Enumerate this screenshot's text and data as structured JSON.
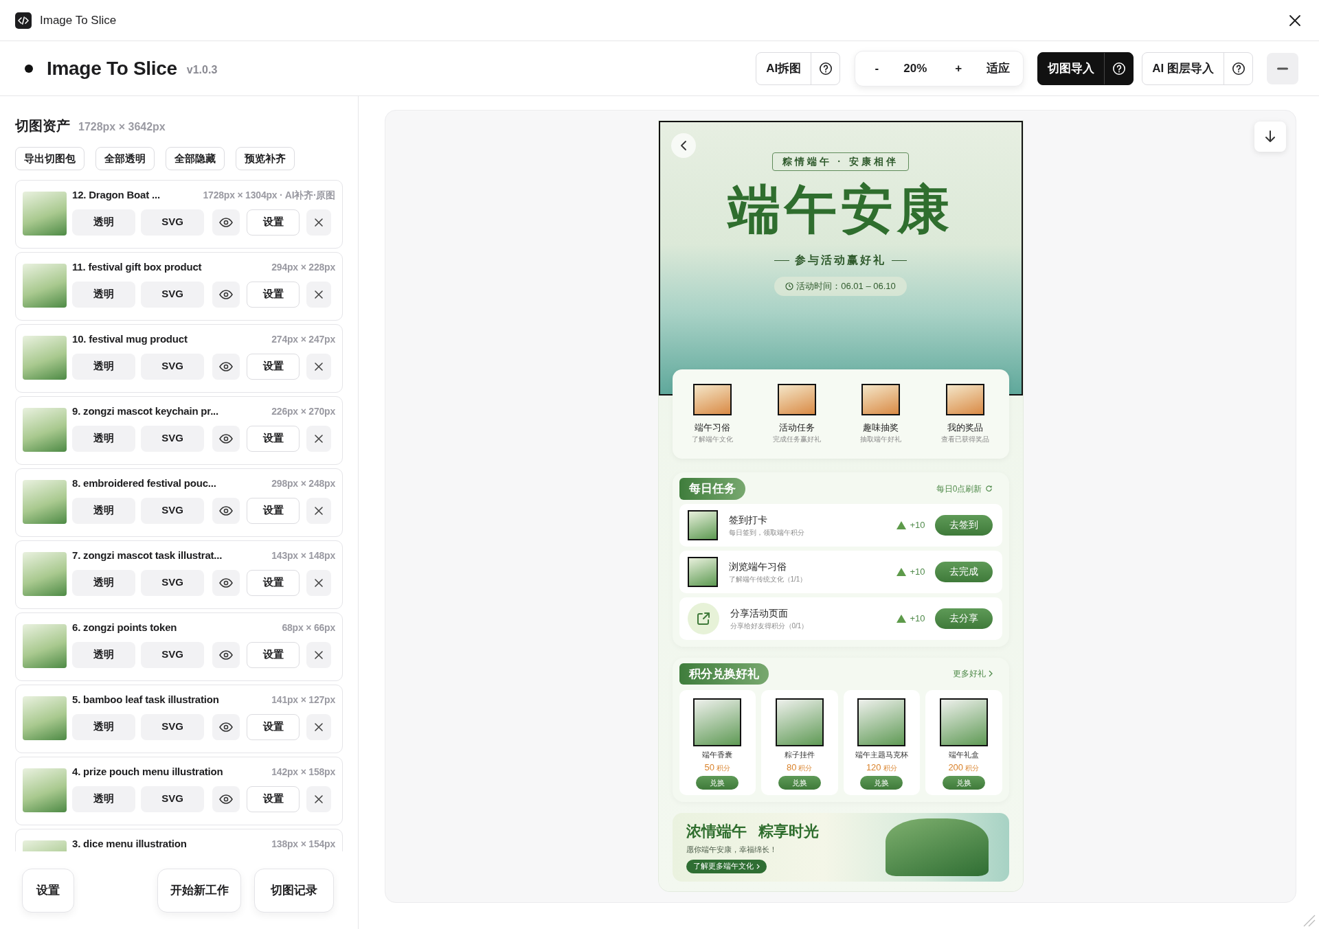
{
  "window": {
    "title": "Image To Slice"
  },
  "header": {
    "title": "Image To Slice",
    "version": "v1.0.3",
    "ai_split": {
      "label": "AI拆图"
    },
    "zoom": {
      "minus": "-",
      "value": "20%",
      "plus": "+",
      "fit": "适应"
    },
    "slice_import": {
      "label": "切图导入"
    },
    "ai_layer_import": {
      "label": "AI 图层导入"
    }
  },
  "assets": {
    "title": "切图资产",
    "size": "1728px × 3642px",
    "actions": [
      "导出切图包",
      "全部透明",
      "全部隐藏",
      "预览补齐"
    ],
    "items": [
      {
        "name": "12. Dragon Boat ...",
        "size": "1728px × 1304px · AI补齐·原图",
        "transparent": "透明",
        "svg": "SVG",
        "settings": "设置"
      },
      {
        "name": "11. festival gift box product",
        "size": "294px × 228px",
        "transparent": "透明",
        "svg": "SVG",
        "settings": "设置"
      },
      {
        "name": "10. festival mug product",
        "size": "274px × 247px",
        "transparent": "透明",
        "svg": "SVG",
        "settings": "设置"
      },
      {
        "name": "9. zongzi mascot keychain pr...",
        "size": "226px × 270px",
        "transparent": "透明",
        "svg": "SVG",
        "settings": "设置"
      },
      {
        "name": "8. embroidered festival pouc...",
        "size": "298px × 248px",
        "transparent": "透明",
        "svg": "SVG",
        "settings": "设置"
      },
      {
        "name": "7. zongzi mascot task illustrat...",
        "size": "143px × 148px",
        "transparent": "透明",
        "svg": "SVG",
        "settings": "设置"
      },
      {
        "name": "6. zongzi points token",
        "size": "68px × 66px",
        "transparent": "透明",
        "svg": "SVG",
        "settings": "设置"
      },
      {
        "name": "5. bamboo leaf task illustration",
        "size": "141px × 127px",
        "transparent": "透明",
        "svg": "SVG",
        "settings": "设置"
      },
      {
        "name": "4. prize pouch menu illustration",
        "size": "142px × 158px",
        "transparent": "透明",
        "svg": "SVG",
        "settings": "设置"
      },
      {
        "name": "3. dice menu illustration",
        "size": "138px × 154px"
      }
    ]
  },
  "footer": {
    "settings": "设置",
    "new_work": "开始新工作",
    "history": "切图记录"
  },
  "preview": {
    "banner": {
      "kicker": "粽情端午 · 安康相伴",
      "title": "端午安康",
      "subtitle": "参与活动赢好礼",
      "time": "活动时间：06.01 – 06.10"
    },
    "nav": [
      {
        "title": "端午习俗",
        "subtitle": "了解端午文化"
      },
      {
        "title": "活动任务",
        "subtitle": "完成任务赢好礼"
      },
      {
        "title": "趣味抽奖",
        "subtitle": "抽取端午好礼"
      },
      {
        "title": "我的奖品",
        "subtitle": "查看已获得奖品"
      }
    ],
    "daily": {
      "title": "每日任务",
      "refresh": "每日0点刷新",
      "tasks": [
        {
          "kind": "image",
          "title": "签到打卡",
          "desc": "每日签到，领取端午积分",
          "points": "+10",
          "action": "去签到"
        },
        {
          "kind": "image",
          "title": "浏览端午习俗",
          "desc": "了解端午传统文化（1/1）",
          "points": "+10",
          "action": "去完成"
        },
        {
          "kind": "share",
          "title": "分享活动页面",
          "desc": "分享给好友得积分（0/1）",
          "points": "+10",
          "action": "去分享"
        }
      ]
    },
    "exchange": {
      "title": "积分兑换好礼",
      "more": "更多好礼",
      "items": [
        {
          "name": "端午香囊",
          "price": "50",
          "unit": "积分",
          "action": "兑换"
        },
        {
          "name": "粽子挂件",
          "price": "80",
          "unit": "积分",
          "action": "兑换"
        },
        {
          "name": "端午主题马克杯",
          "price": "120",
          "unit": "积分",
          "action": "兑换"
        },
        {
          "name": "端午礼盒",
          "price": "200",
          "unit": "积分",
          "action": "兑换"
        }
      ]
    },
    "promo": {
      "title": "浓情端午 粽享时光",
      "subtitle": "愿你端午安康，幸福绵长！",
      "button": "了解更多端午文化"
    }
  }
}
